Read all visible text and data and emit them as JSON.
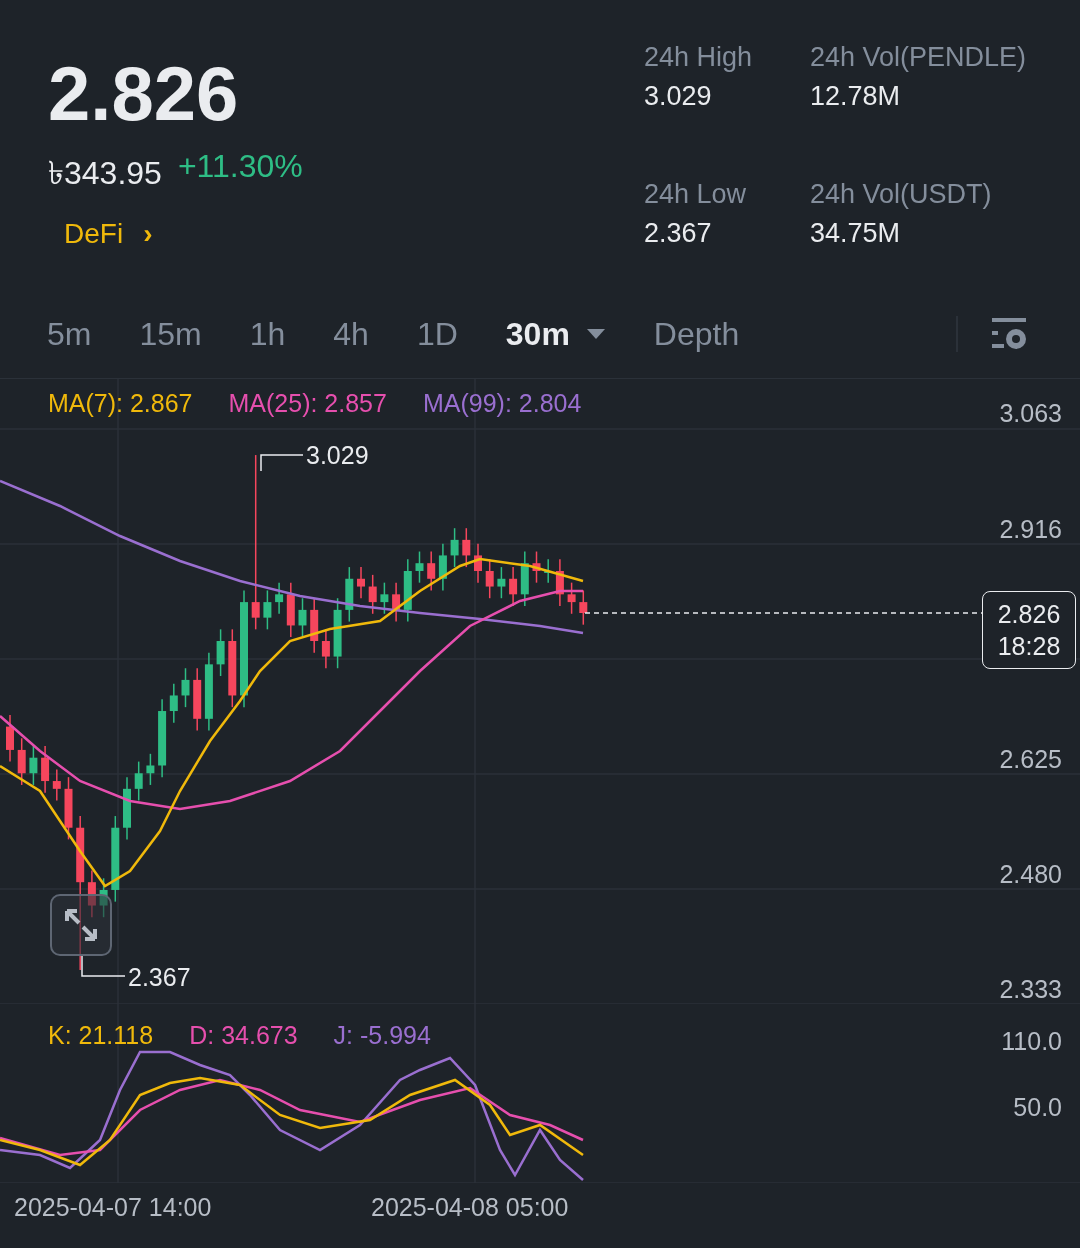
{
  "ticker": {
    "price": "2.826",
    "local_price": "৳343.95",
    "change": "+11.30%",
    "category": "DeFi",
    "category_arrow": "›"
  },
  "stats": [
    {
      "label": "24h High",
      "value": "3.029"
    },
    {
      "label": "24h Vol(PENDLE)",
      "value": "12.78M"
    },
    {
      "label": "24h Low",
      "value": "2.367"
    },
    {
      "label": "24h Vol(USDT)",
      "value": "34.75M"
    }
  ],
  "intervals": [
    {
      "label": "5m",
      "selected": false,
      "kind": "plain"
    },
    {
      "label": "15m",
      "selected": false,
      "kind": "plain"
    },
    {
      "label": "1h",
      "selected": false,
      "kind": "plain"
    },
    {
      "label": "4h",
      "selected": false,
      "kind": "plain"
    },
    {
      "label": "1D",
      "selected": false,
      "kind": "plain"
    },
    {
      "label": "30m",
      "selected": true,
      "kind": "menu"
    },
    {
      "label": "Depth",
      "selected": false,
      "kind": "plain"
    }
  ],
  "chart": {
    "legend": [
      {
        "label": "MA(7): 2.867",
        "color": "#f0b90b"
      },
      {
        "label": "MA(25): 2.857",
        "color": "#e64fae"
      },
      {
        "label": "MA(99): 2.804",
        "color": "#9a6fd0"
      }
    ],
    "y_labels": [
      "3.063",
      "2.916",
      "2.625",
      "2.480",
      "2.333"
    ],
    "high_marker": "3.029",
    "low_marker": "2.367",
    "last_price": "2.826",
    "countdown": "18:28"
  },
  "indicator": {
    "legend": [
      {
        "label": "K: 21.118",
        "color": "#f0b90b"
      },
      {
        "label": "D: 34.673",
        "color": "#e64fae"
      },
      {
        "label": "J: -5.994",
        "color": "#9a6fd0"
      }
    ],
    "y_labels": [
      "110.0",
      "50.0"
    ]
  },
  "x_labels": [
    "2025-04-07 14:00",
    "2025-04-08 05:00"
  ]
}
